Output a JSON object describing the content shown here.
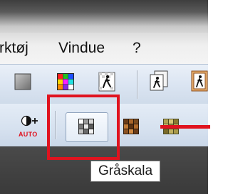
{
  "menubar": {
    "items": [
      {
        "label": "rktøj"
      },
      {
        "label": "Vindue"
      },
      {
        "label": "?"
      }
    ]
  },
  "toolbar2": {
    "auto_label": "AUTO"
  },
  "tooltip": {
    "text": "Gråskala"
  },
  "colors": {
    "highlight_red": "#e0131f",
    "toolbar_blue": "#dbe5f2",
    "menubar_gray": "#efefef"
  },
  "icons": {
    "toolbar1": [
      "gray-square-icon",
      "color-grid-icon",
      "walking-figure-icon",
      "copy-figure-icon",
      "framed-figure-icon"
    ],
    "toolbar2": [
      "auto-contrast-icon",
      "grayscale-grid-icon",
      "sepia-grid-icon",
      "olive-grid-icon"
    ]
  }
}
